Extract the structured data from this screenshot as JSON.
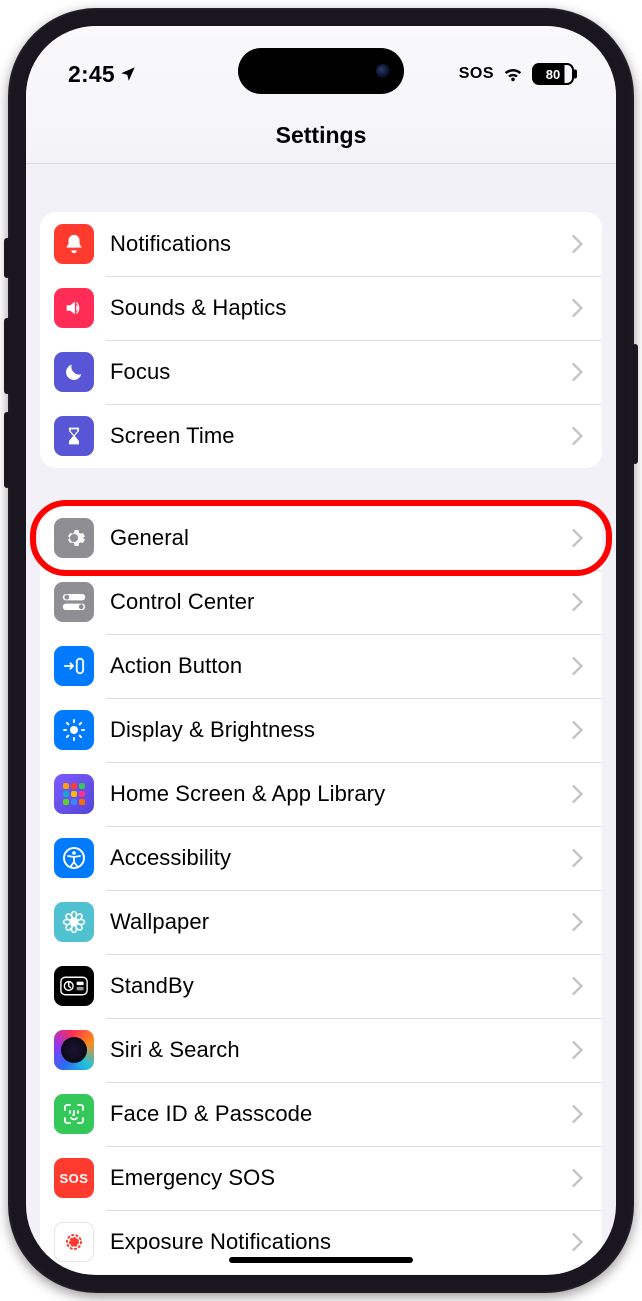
{
  "status": {
    "time": "2:45",
    "sos": "SOS",
    "battery": "80"
  },
  "header": {
    "title": "Settings"
  },
  "groups": [
    {
      "rows": [
        {
          "id": "notifications",
          "label": "Notifications",
          "icon": "bell-icon",
          "bg": "ic-bg-red"
        },
        {
          "id": "sounds",
          "label": "Sounds & Haptics",
          "icon": "speaker-icon",
          "bg": "ic-bg-pink"
        },
        {
          "id": "focus",
          "label": "Focus",
          "icon": "moon-icon",
          "bg": "ic-bg-indigo"
        },
        {
          "id": "screentime",
          "label": "Screen Time",
          "icon": "hourglass-icon",
          "bg": "ic-bg-indigo"
        }
      ]
    },
    {
      "rows": [
        {
          "id": "general",
          "label": "General",
          "icon": "gear-icon",
          "bg": "ic-bg-gray",
          "highlight": true
        },
        {
          "id": "control-center",
          "label": "Control Center",
          "icon": "switches-icon",
          "bg": "ic-bg-gray"
        },
        {
          "id": "action-button",
          "label": "Action Button",
          "icon": "action-icon",
          "bg": "ic-bg-blue"
        },
        {
          "id": "display",
          "label": "Display & Brightness",
          "icon": "sun-icon",
          "bg": "ic-bg-blue"
        },
        {
          "id": "home-screen",
          "label": "Home Screen & App Library",
          "icon": "grid-icon",
          "bg": "ic-bg-home"
        },
        {
          "id": "accessibility",
          "label": "Accessibility",
          "icon": "accessibility-icon",
          "bg": "ic-bg-blue"
        },
        {
          "id": "wallpaper",
          "label": "Wallpaper",
          "icon": "flower-icon",
          "bg": "ic-bg-teal"
        },
        {
          "id": "standby",
          "label": "StandBy",
          "icon": "standby-icon",
          "bg": "ic-bg-black"
        },
        {
          "id": "siri",
          "label": "Siri & Search",
          "icon": "siri-icon",
          "bg": "ic-bg-siri"
        },
        {
          "id": "faceid",
          "label": "Face ID & Passcode",
          "icon": "faceid-icon",
          "bg": "ic-bg-green"
        },
        {
          "id": "emergency",
          "label": "Emergency SOS",
          "icon": "sos-icon",
          "bg": "ic-bg-sred"
        },
        {
          "id": "exposure",
          "label": "Exposure Notifications",
          "icon": "exposure-icon",
          "bg": "ic-bg-white"
        }
      ]
    }
  ]
}
